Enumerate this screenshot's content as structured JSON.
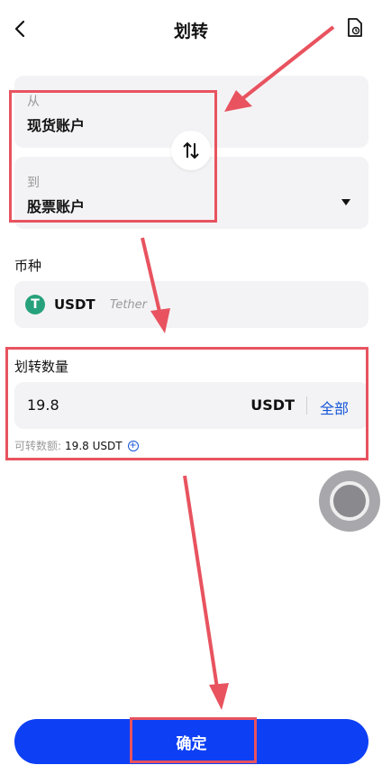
{
  "header": {
    "title": "划转",
    "back_icon": "chevron-left-icon",
    "history_icon": "document-clock-icon"
  },
  "transfer": {
    "from_label": "从",
    "from_value": "现货账户",
    "to_label": "到",
    "to_value": "股票账户",
    "swap_icon": "swap-vertical-icon"
  },
  "coin": {
    "section_label": "币种",
    "symbol": "USDT",
    "name": "Tether",
    "icon": "tether-icon",
    "icon_glyph": "T"
  },
  "amount": {
    "section_label": "划转数量",
    "value": "19.8",
    "unit": "USDT",
    "all_label": "全部",
    "available_label": "可转数额:",
    "available_value": "19.8 USDT"
  },
  "confirm_label": "确定",
  "colors": {
    "accent": "#1656d8",
    "button": "#0d3ff5",
    "annotation": "#e8535f",
    "tether": "#26a17b"
  }
}
